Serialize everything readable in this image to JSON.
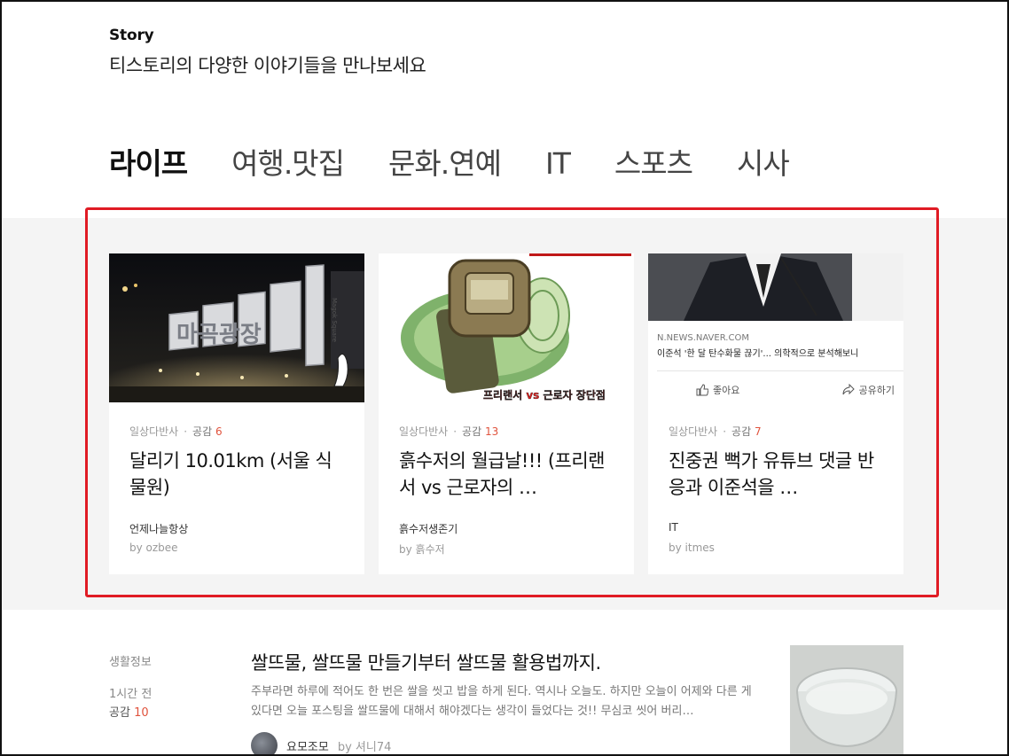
{
  "header": {
    "brand": "Story",
    "tagline": "티스토리의 다양한 이야기들을 만나보세요"
  },
  "tabs": [
    {
      "label": "라이프",
      "active": true
    },
    {
      "label": "여행.맛집",
      "active": false
    },
    {
      "label": "문화.연예",
      "active": false
    },
    {
      "label": "IT",
      "active": false
    },
    {
      "label": "스포츠",
      "active": false
    },
    {
      "label": "시사",
      "active": false
    }
  ],
  "cards": [
    {
      "category": "일상다반사",
      "likes_label": "공감",
      "likes": "6",
      "title": "달리기 10.01km (서울 식물원)",
      "blog": "언제나늘항상",
      "author": "by ozbee",
      "thumb_sign_text": "마곡광장",
      "thumb_sign_small": "Magok Square"
    },
    {
      "category": "일상다반사",
      "likes_label": "공감",
      "likes": "13",
      "title": "흙수저의 월급날!!! (프리랜서 vs 근로자의 …",
      "blog": "흙수저생존기",
      "author": "by 흙수저",
      "thumb_caption": "프리랜서 vs 근로자 장단점"
    },
    {
      "category": "일상다반사",
      "likes_label": "공감",
      "likes": "7",
      "title": "진중권 뻑가 유튜브 댓글 반응과 이준석을 …",
      "blog": "IT",
      "author": "by itmes",
      "preview": {
        "domain": "N.NEWS.NAVER.COM",
        "title": "이준석 '한 달 탄수화물 끊기'... 의학적으로 분석해보니",
        "like_label": "좋아요",
        "share_label": "공유하기"
      }
    }
  ],
  "list_item": {
    "category": "생활정보",
    "time": "1시간 전",
    "likes_label": "공감",
    "likes": "10",
    "title": "쌀뜨물, 쌀뜨물 만들기부터 쌀뜨물 활용법까지.",
    "summary": "주부라면 하루에 적어도 한 번은 쌀을 씻고 밥을 하게 된다. 역시나 오늘도. 하지만 오늘이 어제와 다른 게 있다면 오늘 포스팅을 쌀뜨물에 대해서 해야겠다는 생각이 들었다는 것!! 무심코 씻어 버리…",
    "blog": "요모조모",
    "author": "by 셔니74"
  },
  "colors": {
    "accent_underline": "#f15a4e",
    "likes_count": "#e0533d",
    "highlight_border": "#e01b24",
    "band_background": "#f4f4f4"
  }
}
